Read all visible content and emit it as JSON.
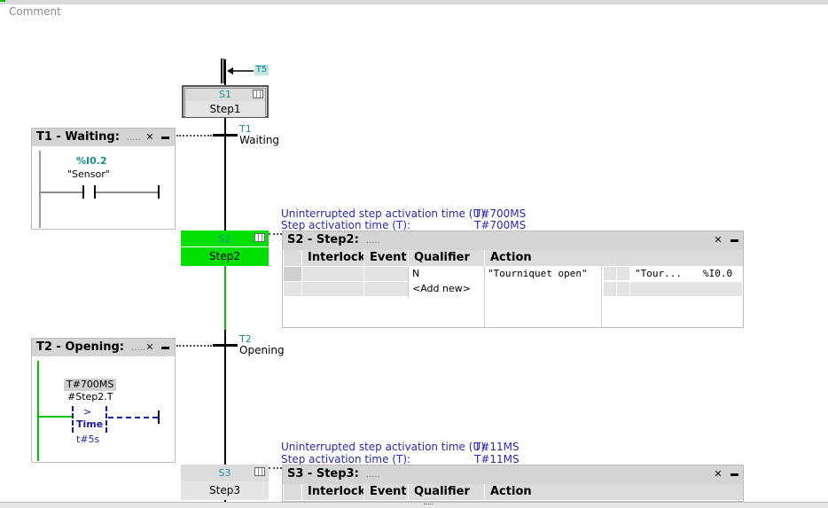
{
  "comment_label": "Comment",
  "jump": {
    "label": "T5"
  },
  "steps": [
    {
      "num": "S1",
      "name": "Step1"
    },
    {
      "num": "S2",
      "name": "Step2"
    },
    {
      "num": "S3",
      "name": "Step3"
    }
  ],
  "transitions": [
    {
      "num": "T1",
      "name": "Waiting",
      "panel_title": "T1 - Waiting:",
      "panel_dots": "....."
    },
    {
      "num": "T2",
      "name": "Opening",
      "panel_title": "T2 - Opening:",
      "panel_dots": "....."
    }
  ],
  "t1_contact": {
    "address": "%I0.2",
    "tag": "\"Sensor\""
  },
  "t2_compare": {
    "value": "T#700MS",
    "operand": "#Step2.T",
    "op": ">",
    "type": "Time",
    "ref": "t#5s"
  },
  "s2_info": {
    "u_label": "Uninterrupted step activation time (U):",
    "u_value": "T#700MS",
    "t_label": "Step activation time (T):",
    "t_value": "T#700MS"
  },
  "s3_info": {
    "u_label": "Uninterrupted step activation time (U):",
    "u_value": "T#11MS",
    "t_label": "Step activation time (T):",
    "t_value": "T#11MS"
  },
  "s2_table": {
    "title": "S2 - Step2:",
    "dots": ".....",
    "headers": [
      "Interlock",
      "Event",
      "Qualifier",
      "Action"
    ],
    "rows": [
      {
        "qualifier": "N",
        "action": "\"Tourniquet open\"",
        "var": "\"Tour...",
        "addr": "%I0.0"
      },
      {
        "qualifier": "<Add new>"
      }
    ]
  },
  "s3_table": {
    "title": "S3 - Step3:",
    "dots": ".....",
    "headers": [
      "Interlock",
      "Event",
      "Qualifier",
      "Action"
    ]
  },
  "colors": {
    "active": "#00e000",
    "teal": "#1a8f8f",
    "info_blue": "#2b2bb0"
  }
}
